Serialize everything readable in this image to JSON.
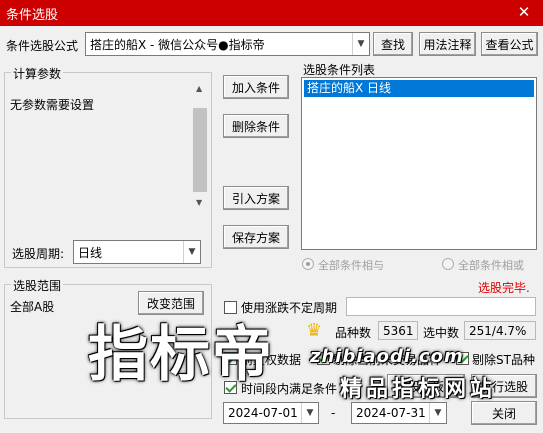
{
  "window": {
    "title": "条件选股",
    "close_glyph": "✕"
  },
  "formula": {
    "label": "条件选股公式",
    "value": "搭庄的船X  -  微信公众号●指标帝",
    "find_label": "查找",
    "usage_label": "用法注释",
    "view_label": "查看公式"
  },
  "params": {
    "legend": "计算参数",
    "empty_text": "无参数需要设置",
    "period_label": "选股周期:",
    "period_value": "日线"
  },
  "actions": {
    "add_label": "加入条件",
    "delete_label": "删除条件",
    "import_label": "引入方案",
    "save_label": "保存方案"
  },
  "conditions": {
    "legend": "选股条件列表",
    "items": [
      "搭庄的船X  日线"
    ],
    "logic_and": "全部条件相与",
    "logic_or": "全部条件相或",
    "status": "选股完毕.",
    "status_color": "#e00000"
  },
  "range": {
    "legend": "选股范围",
    "value": "全部A股",
    "change_label": "改变范围"
  },
  "options": {
    "use_undetermined_label": "使用涨跌不定周期",
    "count_label": "品种数",
    "count_value": "5361",
    "selected_label": "选中数",
    "selected_value": "251/4.7%",
    "prev_label": "前复权数据",
    "exclude_untraded_label": "剔除当前未交易品种",
    "exclude_st_label": "剔除ST品种",
    "time_label": "时间段内满足条件",
    "select_to_block_label": "选股入板块",
    "execute_label": "执行选股",
    "close_label": "关闭"
  },
  "dates": {
    "start": "2024-07-01",
    "separator": "-",
    "end": "2024-07-31"
  },
  "watermark": {
    "main": "指标帝",
    "site": "zhibiaodi.com",
    "slogan": "精品指标网站"
  }
}
